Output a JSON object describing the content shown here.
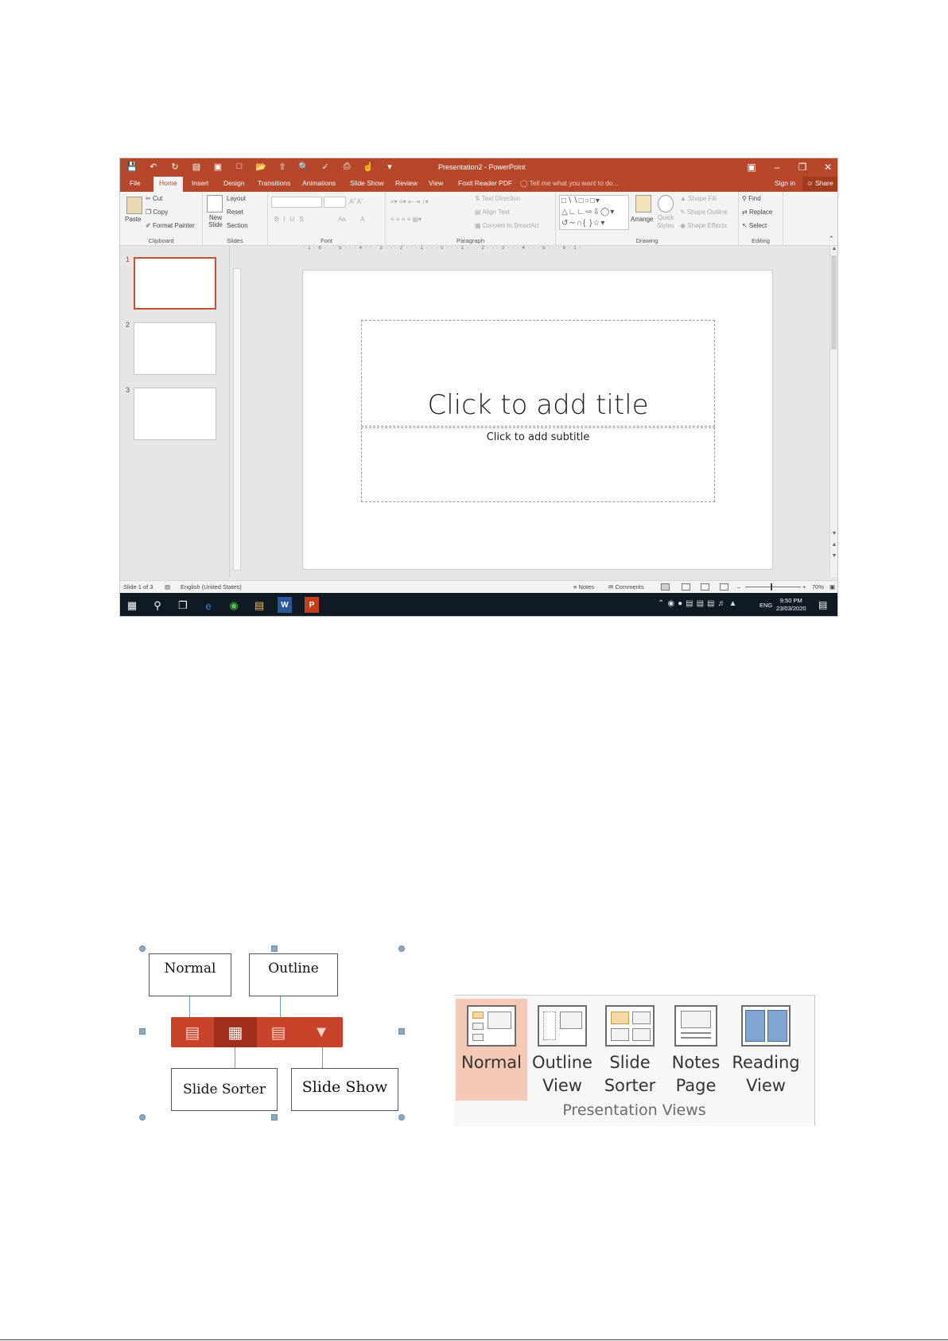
{
  "ppt": {
    "app_title": "Presentation2 - PowerPoint",
    "tabs": [
      "File",
      "Home",
      "Insert",
      "Design",
      "Transitions",
      "Animations",
      "Slide Show",
      "Review",
      "View",
      "Foxit Reader PDF"
    ],
    "active_tab": "Home",
    "tell_me": "Tell me what you want to do...",
    "sign_in": "Sign in",
    "share": "Share",
    "clipboard": {
      "paste": "Paste",
      "cut": "Cut",
      "copy": "Copy",
      "format_painter": "Format Painter",
      "label": "Clipboard"
    },
    "slides_group": {
      "new_slide": "New Slide",
      "layout": "Layout",
      "reset": "Reset",
      "section": "Section",
      "label": "Slides"
    },
    "font_group": {
      "label": "Font",
      "bold": "B",
      "italic": "I",
      "underline": "U",
      "strike": "S",
      "aa": "Aa",
      "a": "A"
    },
    "paragraph_group": {
      "text_direction": "Text Direction",
      "align_text": "Align Text",
      "convert_smartart": "Convert to SmartArt",
      "label": "Paragraph"
    },
    "drawing_group": {
      "arrange": "Arrange",
      "quick_styles": "Quick Styles",
      "shape_fill": "Shape Fill",
      "shape_outline": "Shape Outline",
      "shape_effects": "Shape Effects",
      "label": "Drawing"
    },
    "editing_group": {
      "find": "Find",
      "replace": "Replace",
      "select": "Select",
      "label": "Editing"
    },
    "ruler_top": "· 1 · 6 · · · 5 · · · 4 · · · 3 · · · 2 · · · 1 · · · 0 · · · 1 · · · 2 · · · 3 · · · 4 · · · 5 · · · 6 · 1 ·",
    "thumbnails": [
      "1",
      "2",
      "3"
    ],
    "slide": {
      "title_placeholder": "Click to add title",
      "subtitle_placeholder": "Click to add subtitle"
    },
    "status": {
      "slide_info": "Slide 1 of 3",
      "language": "English (United States)",
      "notes": "Notes",
      "comments": "Comments",
      "zoom": "70%"
    },
    "taskbar": {
      "time": "9:50 PM",
      "date": "23/03/2020",
      "lang": "ENG",
      "word_label": "W",
      "ppt_label": "P"
    }
  },
  "diagram": {
    "normal": "Normal",
    "outline": "Outline",
    "slide_sorter": "Slide Sorter",
    "slide_show": "Slide Show"
  },
  "presentation_views": {
    "buttons": [
      {
        "label": "Normal"
      },
      {
        "label": "Outline\nView"
      },
      {
        "label": "Slide\nSorter"
      },
      {
        "label": "Notes\nPage"
      },
      {
        "label": "Reading\nView"
      }
    ],
    "group_label": "Presentation Views"
  },
  "colors": {
    "accent": "#b7472a",
    "active_view": "#f6c9b7"
  }
}
